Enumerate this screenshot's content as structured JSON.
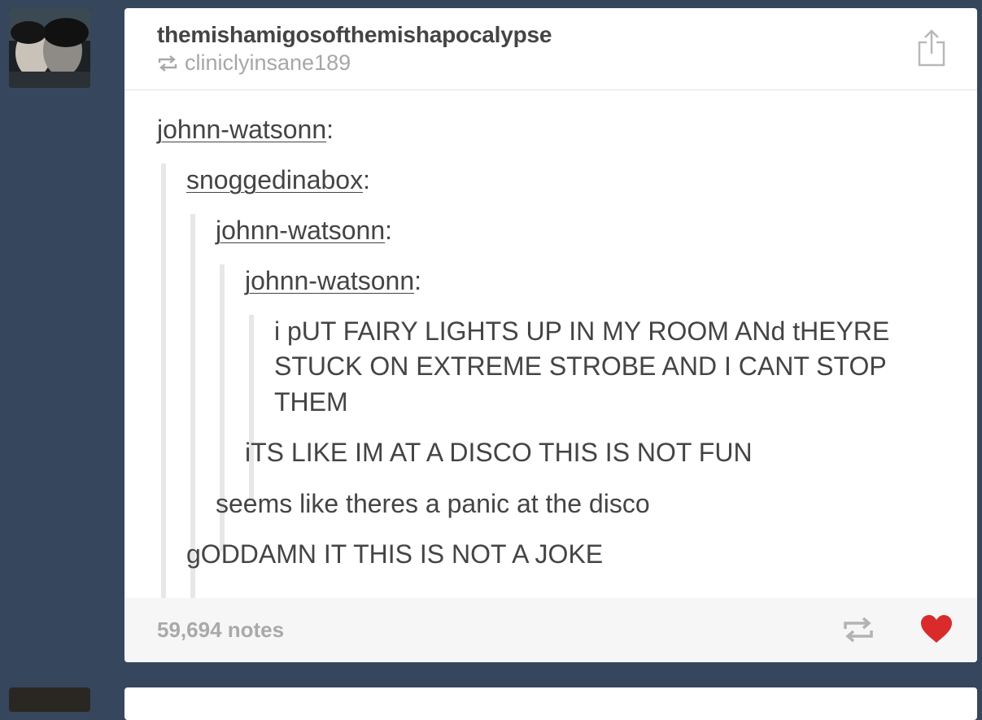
{
  "post": {
    "blog_name": "themishamigosofthemishapocalypse",
    "reblogged_from": "cliniclyinsane189",
    "thread": [
      {
        "user": "johnn-watsonn"
      },
      {
        "user": "snoggedinabox"
      },
      {
        "user": "johnn-watsonn"
      },
      {
        "user": "johnn-watsonn"
      }
    ],
    "messages": {
      "m4_line1": "i pUT FAIRY LIGHTS UP IN MY ROOM ANd tHEYRE",
      "m4_line2": "STUCK ON EXTREME STROBE AND I CANT STOP",
      "m4_line3": "THEM",
      "m3": "iTS LIKE IM AT A DISCO THIS IS NOT FUN",
      "m2": "seems like theres a panic at the disco",
      "m1": "gODDAMN IT THIS IS NOT A JOKE"
    },
    "footer": {
      "notes": "59,694 notes"
    },
    "colors": {
      "background": "#36465d",
      "like": "#d92b2b",
      "muted": "#a9a9a9"
    },
    "icons": [
      "reblog-icon",
      "share-icon",
      "heart-icon"
    ]
  }
}
